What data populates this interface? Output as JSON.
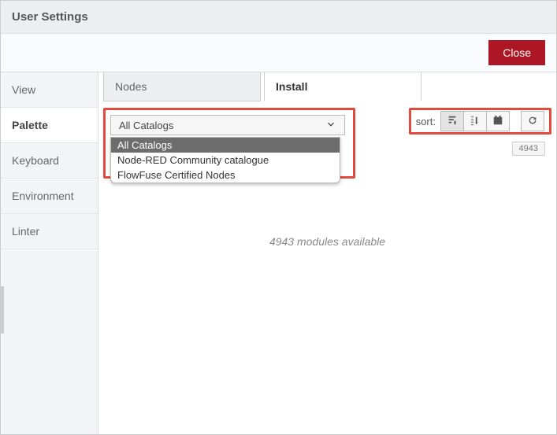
{
  "header": {
    "title": "User Settings"
  },
  "actions": {
    "close": "Close"
  },
  "sidebar": {
    "items": [
      {
        "label": "View"
      },
      {
        "label": "Palette"
      },
      {
        "label": "Keyboard"
      },
      {
        "label": "Environment"
      },
      {
        "label": "Linter"
      }
    ],
    "activeIndex": 1
  },
  "tabs": {
    "items": [
      {
        "label": "Nodes"
      },
      {
        "label": "Install"
      }
    ],
    "activeIndex": 1
  },
  "catalog": {
    "selected": "All Catalogs",
    "options": [
      "All Catalogs",
      "Node-RED Community catalogue",
      "FlowFuse Certified Nodes"
    ]
  },
  "sort": {
    "label": "sort:"
  },
  "countBadge": "4943",
  "modulesText": "4943 modules available"
}
